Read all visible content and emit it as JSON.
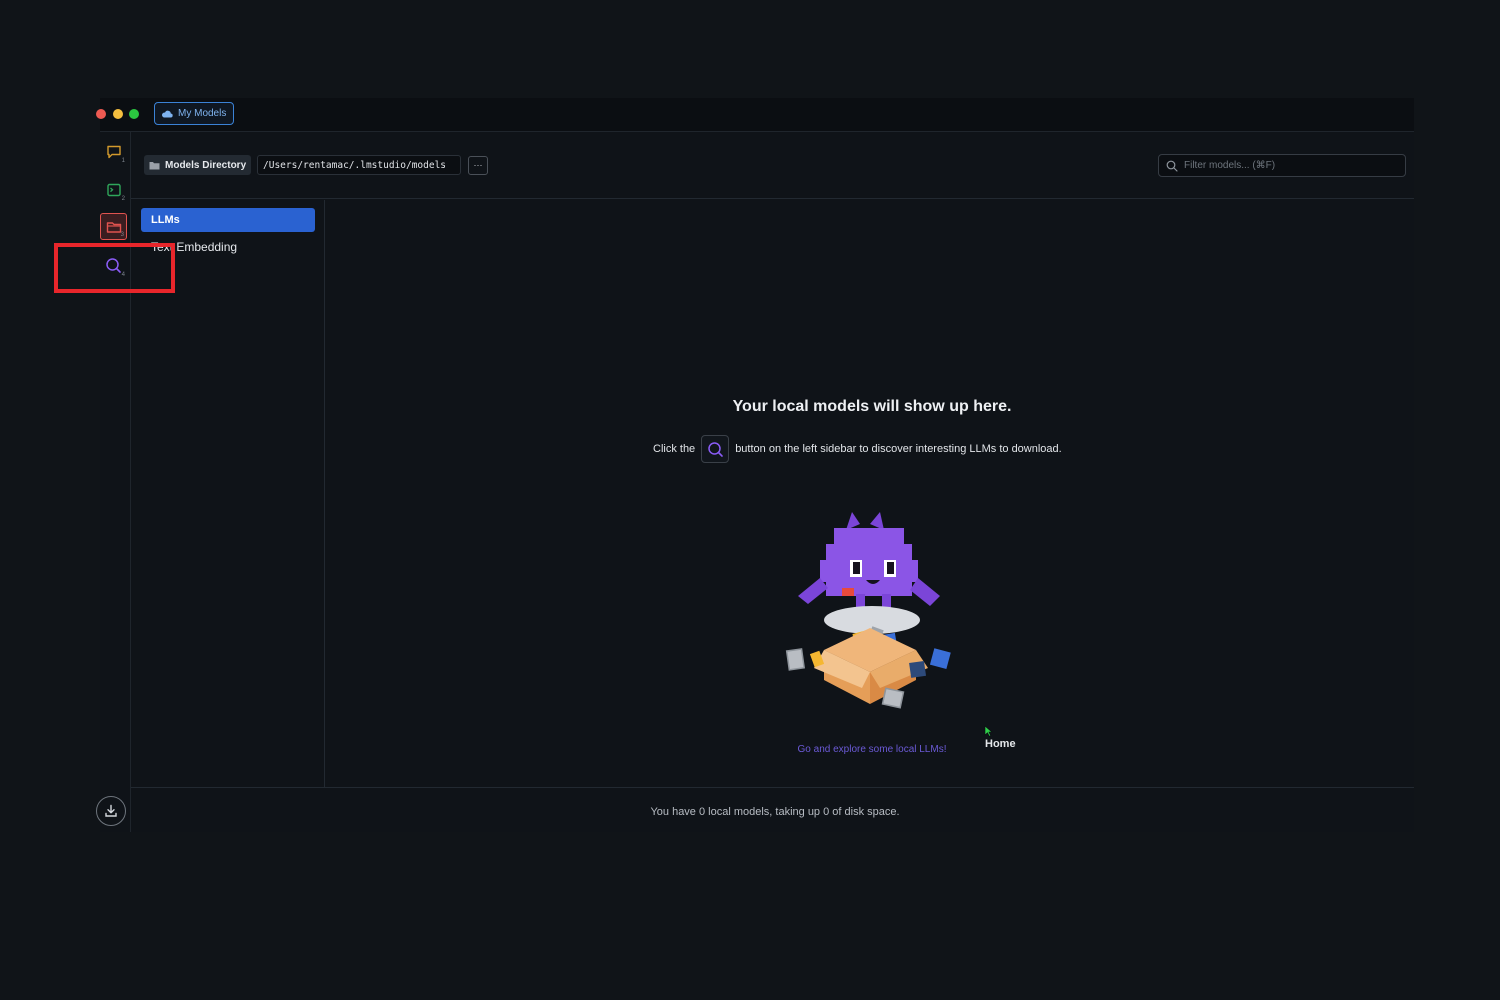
{
  "titlebar": {
    "tab_label": "My Models"
  },
  "rail": {
    "items": [
      {
        "name": "chat",
        "icon": "chat-icon",
        "badge": "1",
        "color": "#d39a2c"
      },
      {
        "name": "playground",
        "icon": "terminal-icon",
        "badge": "2",
        "color": "#2fa65b"
      },
      {
        "name": "my-models",
        "icon": "folder-icon",
        "badge": "3",
        "color": "#e0534f",
        "active": true
      },
      {
        "name": "search",
        "icon": "search-icon",
        "badge": "4",
        "color": "#8a5cf6"
      }
    ],
    "download_icon": "download-icon"
  },
  "toolbar": {
    "directory_label": "Models Directory",
    "directory_path": "/Users/rentamac/.lmstudio/models",
    "more_label": "···",
    "filter_placeholder": "Filter models... (⌘F)"
  },
  "categories": [
    {
      "label": "LLMs",
      "active": true
    },
    {
      "label": "Text Embedding",
      "active": false
    }
  ],
  "empty_state": {
    "title": "Your local models will show up here.",
    "hint_before": "Click the",
    "hint_after": "button on the left sidebar to discover interesting LLMs to download.",
    "explore_link": "Go and explore some local LLMs!"
  },
  "tooltip": {
    "label": "Home"
  },
  "footer": {
    "summary": "You have 0 local models, taking up 0 of disk space."
  },
  "colors": {
    "accent": "#2a62d1",
    "highlight": "#e8262b",
    "link": "#6b5ad6"
  }
}
